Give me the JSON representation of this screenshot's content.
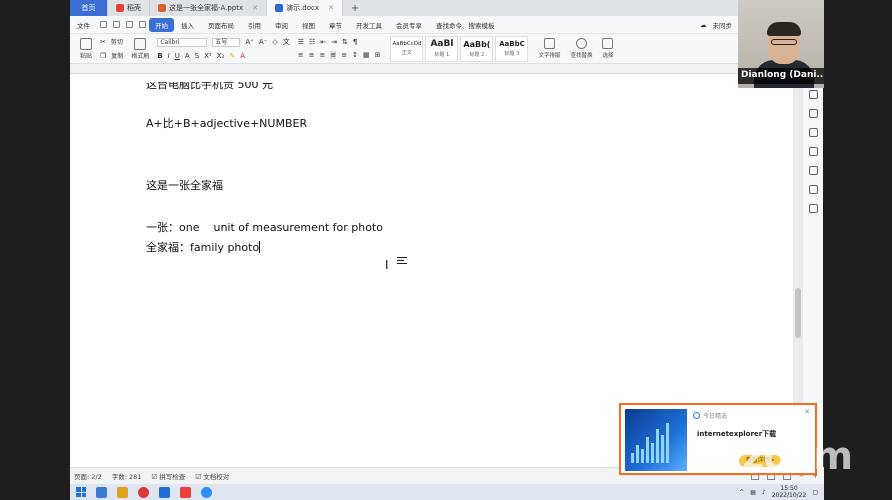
{
  "tabs": [
    {
      "label": "首页",
      "kind": "home"
    },
    {
      "label": "稻壳",
      "kind": "doc",
      "color": "#e8413c"
    },
    {
      "label": "这是一张全家福-A.pptx",
      "kind": "ppt",
      "color": "#e0612c"
    },
    {
      "label": "演示.docx",
      "kind": "docx",
      "color": "#2b67d6",
      "active": true
    }
  ],
  "menu": {
    "file": "文件",
    "items": [
      "开始",
      "插入",
      "页面布局",
      "引用",
      "审阅",
      "视图",
      "章节",
      "开发工具",
      "会员专享"
    ],
    "active": "开始",
    "search": "查找命令、搜索模板",
    "unsynced": "未同步"
  },
  "ribbon": {
    "paste": "粘贴",
    "cut": "剪切",
    "copy": "复制",
    "format_painter": "格式刷",
    "font_name": "Calibri",
    "font_size": "五号",
    "styles": [
      {
        "sample": "AaBbCcDd",
        "label": "正文",
        "small": true
      },
      {
        "sample": "AaBl",
        "label": "标题 1",
        "small": false
      },
      {
        "sample": "AaBb(",
        "label": "标题 2",
        "small": false
      },
      {
        "sample": "AaBbC",
        "label": "标题 3",
        "small": false
      }
    ],
    "text_layout": "文字排版",
    "find_replace": "查找替换",
    "select": "选择"
  },
  "document": {
    "line_cut": "这台电脑比手机贵 500 元",
    "line1": "A+比+B+adjective+NUMBER",
    "line2": "这是一张全家福",
    "line3_label": "一张：",
    "line3_a": "one",
    "line3_b": "unit of measurement for photo",
    "line4_label": "全家福：",
    "line4_text": "family photo"
  },
  "status": {
    "page": "页面: 2/2",
    "words": "字数: 281",
    "spell": "拼写检查",
    "proof": "文档校对"
  },
  "webcam": {
    "name": "Dianlong (Dani..."
  },
  "notification": {
    "source": "今日精选",
    "title": "internetexplorer下载",
    "button": "查看详情>"
  },
  "clock": {
    "time": "15:50",
    "date": "2022/10/22"
  },
  "zoom_logo": "zoom"
}
